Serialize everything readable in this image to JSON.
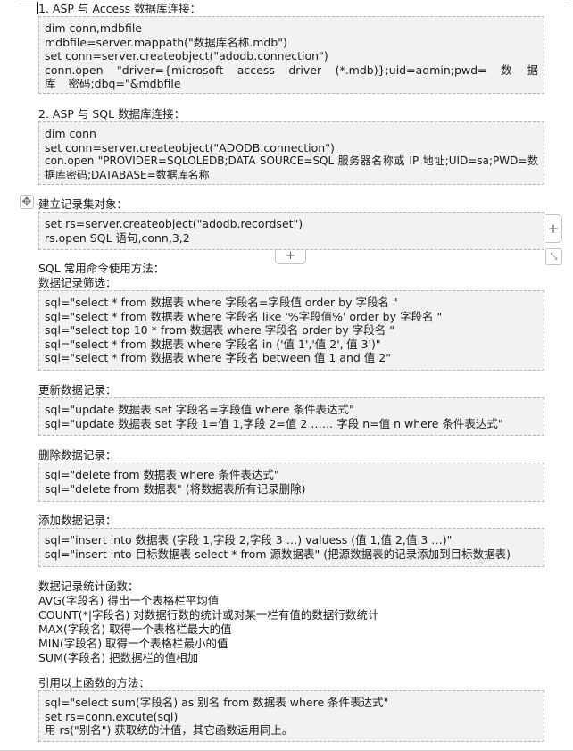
{
  "sections": [
    {
      "heading": "1. ASP 与 Access 数据库连接：",
      "lines": [
        "dim conn,mdbfile",
        "mdbfile=server.mappath(\"数据库名称.mdb\")",
        "set conn=server.createobject(\"adodb.connection\")",
        "conn.open \"driver={microsoft access driver (*.mdb)};uid=admin;pwd= 数 据 库 密码;dbq=\"&mdbfile"
      ]
    },
    {
      "heading": "2. ASP 与 SQL 数据库连接：",
      "lines": [
        "dim conn",
        "set conn=server.createobject(\"ADODB.connection\")",
        "con.open \"PROVIDER=SQLOLEDB;DATA SOURCE=SQL 服务器名称或 IP 地址;UID=sa;PWD=数据库密码;DATABASE=数据库名称"
      ]
    },
    {
      "heading": "建立记录集对象：",
      "lines": [
        "set rs=server.createobject(\"adodb.recordset\")",
        "rs.open SQL 语句,conn,3,2"
      ]
    },
    {
      "heading_pre": "SQL 常用命令使用方法：",
      "heading": "数据记录筛选：",
      "lines": [
        "sql=\"select * from 数据表 where 字段名=字段值 order by 字段名 \"",
        "sql=\"select * from 数据表 where 字段名 like '%字段值%' order by 字段名 \"",
        "sql=\"select top 10 * from 数据表 where 字段名 order by 字段名 \"",
        "sql=\"select * from 数据表 where 字段名 in ('值 1','值 2','值 3')\"",
        "sql=\"select * from 数据表 where 字段名 between 值 1 and 值 2\""
      ]
    },
    {
      "heading": "更新数据记录：",
      "lines": [
        "sql=\"update 数据表 set 字段名=字段值 where 条件表达式\"",
        "sql=\"update 数据表 set 字段 1=值 1,字段 2=值 2 …… 字段 n=值 n where 条件表达式\""
      ]
    },
    {
      "heading": "删除数据记录：",
      "lines": [
        "sql=\"delete from 数据表 where 条件表达式\"",
        "sql=\"delete from 数据表\" (将数据表所有记录删除)"
      ]
    },
    {
      "heading": "添加数据记录：",
      "lines": [
        "sql=\"insert into 数据表 (字段 1,字段 2,字段 3 …) valuess (值 1,值 2,值 3 …)\"",
        "sql=\"insert into 目标数据表 select * from 源数据表\" (把源数据表的记录添加到目标数据表)"
      ]
    },
    {
      "heading": "数据记录统计函数：",
      "lines": [
        "AVG(字段名) 得出一个表格栏平均值",
        "COUNT(*|字段名) 对数据行数的统计或对某一栏有值的数据行数统计",
        "MAX(字段名) 取得一个表格栏最大的值",
        "MIN(字段名) 取得一个表格栏最小的值",
        "SUM(字段名) 把数据栏的值相加"
      ]
    },
    {
      "heading": "引用以上函数的方法：",
      "lines": [
        "sql=\"select sum(字段名) as 别名 from 数据表 where 条件表达式\"",
        "set rs=conn.excute(sql)",
        "用 rs(\"别名\") 获取统的计值，其它函数运用同上。"
      ]
    }
  ],
  "table_controls": {
    "move_handle_icon": "move-arrows-icon",
    "add_column_icon": "plus-icon",
    "add_row_icon": "plus-icon",
    "resize_icon": "resize-diagonal-icon"
  }
}
